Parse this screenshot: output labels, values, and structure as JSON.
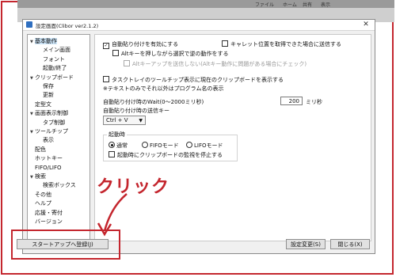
{
  "background": {
    "tab_labels": [
      "ファイル",
      "ホーム",
      "共有",
      "表示"
    ]
  },
  "window": {
    "title": "設定画面(Clibor ver2.1.2)"
  },
  "tree": [
    {
      "label": "基本動作",
      "level": 0,
      "toggle": "▾",
      "selected": true
    },
    {
      "label": "メイン画面",
      "level": 1
    },
    {
      "label": "フォント",
      "level": 1
    },
    {
      "label": "起動/終了",
      "level": 1
    },
    {
      "label": "クリップボード",
      "level": 0,
      "toggle": "▾"
    },
    {
      "label": "保存",
      "level": 1
    },
    {
      "label": "更新",
      "level": 1
    },
    {
      "label": "定型文",
      "level": 0
    },
    {
      "label": "画面表示制御",
      "level": 0,
      "toggle": "▾"
    },
    {
      "label": "タブ制御",
      "level": 1
    },
    {
      "label": "ツールチップ",
      "level": 0,
      "toggle": "▾"
    },
    {
      "label": "表示",
      "level": 1
    },
    {
      "label": "配色",
      "level": 0
    },
    {
      "label": "ホットキー",
      "level": 0
    },
    {
      "label": "FIFO/LIFO",
      "level": 0
    },
    {
      "label": "検索",
      "level": 0,
      "toggle": "▾"
    },
    {
      "label": "検索ボックス",
      "level": 1
    },
    {
      "label": "その他",
      "level": 0
    },
    {
      "label": "ヘルプ",
      "level": 0
    },
    {
      "label": "応援・寄付",
      "level": 0
    },
    {
      "label": "バージョン",
      "level": 0
    }
  ],
  "settings": {
    "auto_paste": {
      "label": "自動貼り付けを有効にする",
      "checked": true
    },
    "send_on_caret": {
      "label": "キャレット位置を取得できた場合に送信する",
      "checked": false
    },
    "alt_reverse": {
      "label": "Altキーを押しながら選択で逆の動作をする",
      "checked": false
    },
    "alt_no_send": {
      "label": "Altキーアップを送信しない(Altキー動作に問題がある場合にチェック)",
      "checked": false
    },
    "tray_tooltip": {
      "label": "タスクトレイのツールチップ表示に現在のクリップボードを表示する",
      "checked": false
    },
    "tray_note": "※テキストのみでそれ以外はプログラム名の表示",
    "wait_label": "自動貼り付け時のWait(0〜2000ミリ秒)",
    "wait_value": "200",
    "wait_unit": "ミリ秒",
    "send_key_label": "自動貼り付け時の送信キー",
    "send_key_value": "Ctrl + V",
    "startup_group": {
      "legend": "起動時",
      "modes": [
        {
          "label": "通常",
          "selected": true
        },
        {
          "label": "FIFOモード",
          "selected": false
        },
        {
          "label": "LIFOモード",
          "selected": false
        }
      ],
      "stop_monitor": {
        "label": "起動時にクリップボードの監視を停止する",
        "checked": false
      }
    }
  },
  "buttons": {
    "startup": "スタートアップへ登録(J)",
    "apply": "設定変更(S)",
    "close": "閉じる(X)"
  },
  "annotation": {
    "text": "クリック"
  },
  "colors": {
    "annotation": "#c4262e",
    "selection": "#cce4f7"
  }
}
